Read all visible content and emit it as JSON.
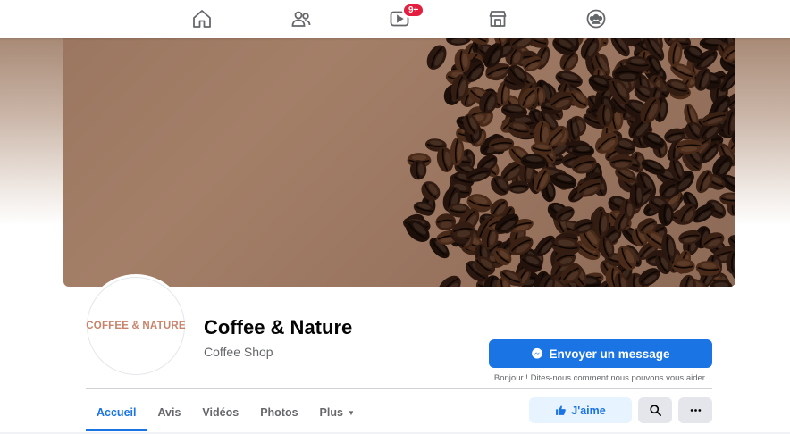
{
  "nav": {
    "icons": [
      "home-icon",
      "friends-icon",
      "watch-icon",
      "marketplace-icon",
      "groups-icon"
    ],
    "watch_badge": "9+"
  },
  "page": {
    "avatar_text": "COFFEE & NATURE",
    "name": "Coffee & Nature",
    "category": "Coffee Shop"
  },
  "actions": {
    "send_message_label": "Envoyer un message",
    "send_message_note": "Bonjour ! Dites-nous comment nous pouvons vous aider.",
    "like_label": "J'aime"
  },
  "tabs": [
    {
      "label": "Accueil",
      "active": true
    },
    {
      "label": "Avis",
      "active": false
    },
    {
      "label": "Vidéos",
      "active": false
    },
    {
      "label": "Photos",
      "active": false
    },
    {
      "label": "Plus",
      "active": false
    }
  ],
  "colors": {
    "accent": "#1b74e4",
    "badge": "#e41e3f",
    "avatar_text": "#c9836a"
  }
}
